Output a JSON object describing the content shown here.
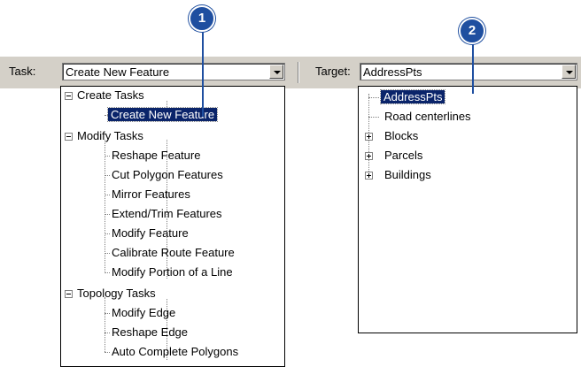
{
  "task": {
    "label": "Task:",
    "value": "Create New Feature",
    "tree": [
      {
        "group": "Create Tasks",
        "items": [
          "Create New Feature"
        ]
      },
      {
        "group": "Modify Tasks",
        "items": [
          "Reshape Feature",
          "Cut Polygon Features",
          "Mirror Features",
          "Extend/Trim Features",
          "Modify Feature",
          "Calibrate Route Feature",
          "Modify Portion of a Line"
        ]
      },
      {
        "group": "Topology Tasks",
        "items": [
          "Modify Edge",
          "Reshape Edge",
          "Auto Complete Polygons"
        ]
      }
    ]
  },
  "target": {
    "label": "Target:",
    "value": "AddressPts",
    "tree": [
      "AddressPts",
      "Road centerlines",
      "Blocks",
      "Parcels",
      "Buildings"
    ]
  },
  "callouts": [
    "1",
    "2"
  ],
  "colors": {
    "accent": "#1f4fa0",
    "selection": "#0a246a",
    "toolbar": "#d4d0c8"
  },
  "icons": [
    "minus-expander-icon",
    "plus-expander-icon",
    "dropdown-arrow-icon"
  ]
}
